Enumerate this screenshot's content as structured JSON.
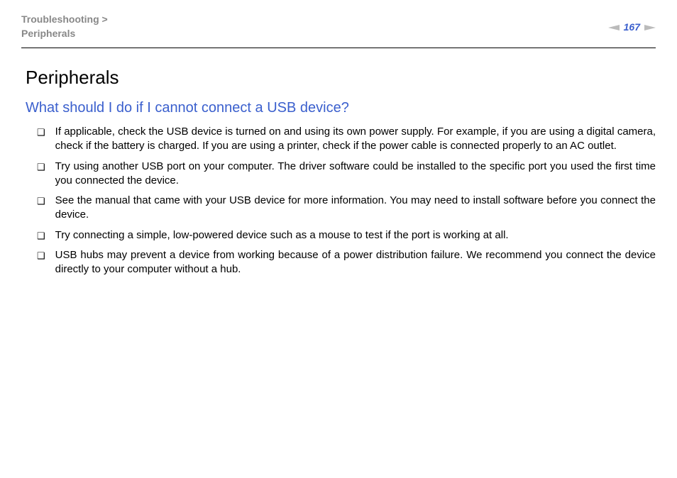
{
  "breadcrumb": {
    "parent": "Troubleshooting >",
    "current": "Peripherals"
  },
  "pageNumber": "167",
  "title": "Peripherals",
  "sectionHeading": "What should I do if I cannot connect a USB device?",
  "bullets": [
    "If applicable, check the USB device is turned on and using its own power supply. For example, if you are using a digital camera, check if the battery is charged. If you are using a printer, check if the power cable is connected properly to an AC outlet.",
    "Try using another USB port on your computer. The driver software could be installed to the specific port you used the first time you connected the device.",
    "See the manual that came with your USB device for more information. You may need to install software before you connect the device.",
    "Try connecting a simple, low-powered device such as a mouse to test if the port is working at all.",
    "USB hubs may prevent a device from working because of a power distribution failure. We recommend you connect the device directly to your computer without a hub."
  ]
}
